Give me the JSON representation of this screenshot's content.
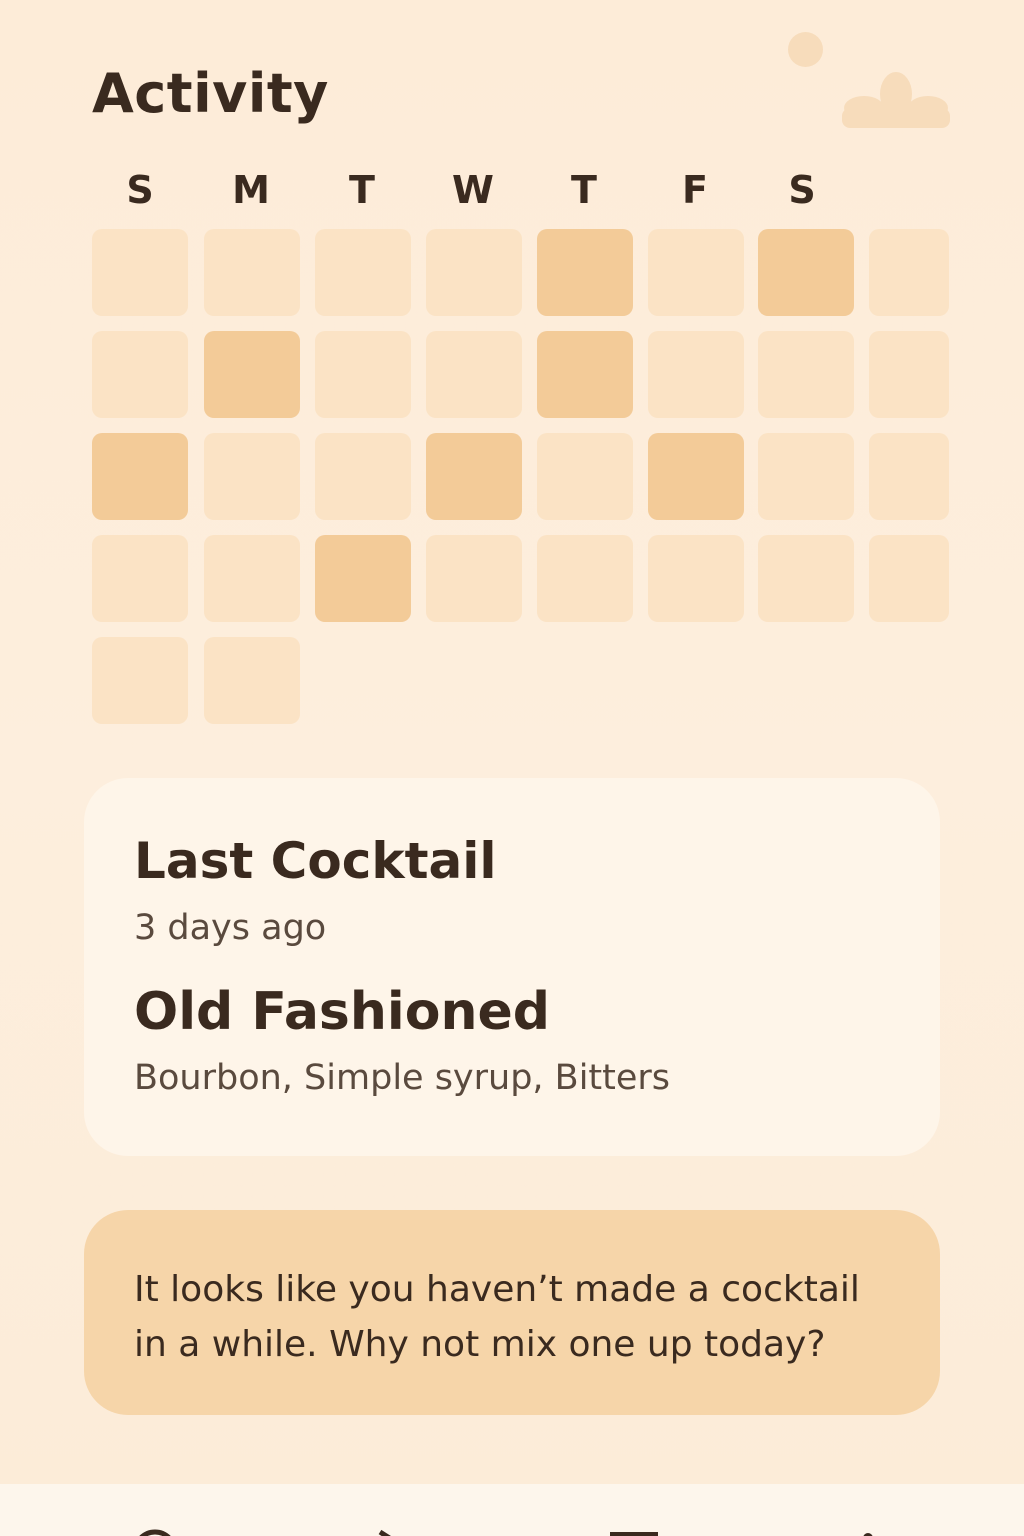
{
  "header": {
    "title": "Activity"
  },
  "calendar": {
    "weekdays": [
      "S",
      "M",
      "T",
      "W",
      "T",
      "F",
      "S"
    ],
    "weeks": [
      [
        0,
        0,
        0,
        0,
        1,
        0,
        1,
        0
      ],
      [
        0,
        1,
        0,
        0,
        1,
        0,
        0,
        0
      ],
      [
        1,
        0,
        0,
        1,
        0,
        1,
        0,
        0
      ],
      [
        0,
        0,
        1,
        0,
        0,
        0,
        0,
        0
      ],
      [
        0,
        0
      ]
    ]
  },
  "last_cocktail": {
    "heading": "Last Cocktail",
    "time_ago": "3 days ago",
    "name": "Old Fashioned",
    "ingredients": "Bourbon, Simple syrup, Bitters"
  },
  "reminder": {
    "message": "It looks like you haven’t made a cocktail in a while. Why not mix one up today?"
  },
  "nav": {
    "items": [
      {
        "icon": "search-icon"
      },
      {
        "icon": "send-icon"
      },
      {
        "icon": "list-icon"
      },
      {
        "icon": "info-icon"
      }
    ]
  },
  "colors": {
    "background": "#fdecd8",
    "cell_inactive": "#fbe3c5",
    "cell_active": "#f3cb98",
    "card": "#fef5e9",
    "reminder": "#f6d5a9",
    "text": "#3a2a1f"
  }
}
